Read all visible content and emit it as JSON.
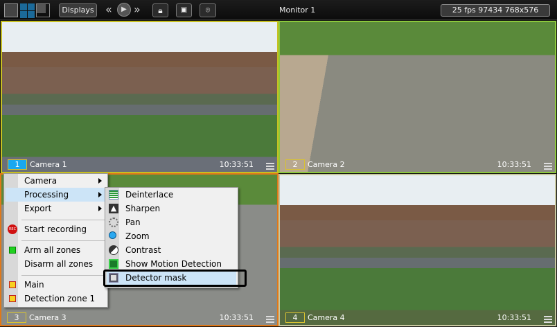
{
  "toolbar": {
    "displays_label": "Displays",
    "monitor_title": "Monitor 1",
    "status": "25 fps  97434 768x576"
  },
  "cameras": [
    {
      "num": "1",
      "name": "Camera 1",
      "time": "10:33:51",
      "border": "#c8c020"
    },
    {
      "num": "2",
      "name": "Camera 2",
      "time": "10:33:51",
      "border": "#8cc83c"
    },
    {
      "num": "3",
      "name": "Camera 3",
      "time": "10:33:51",
      "border": "#e07818"
    },
    {
      "num": "4",
      "name": "Camera 4",
      "time": "10:33:51",
      "border": "#c8c8a0"
    }
  ],
  "context_menu": {
    "items": [
      {
        "label": "Camera",
        "submenu": true
      },
      {
        "label": "Processing",
        "submenu": true,
        "highlighted": true
      },
      {
        "label": "Export",
        "submenu": true
      },
      {
        "label": "Start recording",
        "icon": "rec-icon"
      },
      {
        "label": "Arm all zones",
        "icon": "arm-zone-icon"
      },
      {
        "label": "Disarm all zones"
      },
      {
        "label": "Main",
        "icon": "zone-icon"
      },
      {
        "label": "Detection zone 1",
        "icon": "zone-icon"
      }
    ]
  },
  "processing_submenu": {
    "items": [
      {
        "label": "Deinterlace",
        "icon": "deinterlace-icon",
        "checked": true
      },
      {
        "label": "Sharpen",
        "icon": "sharpen-icon"
      },
      {
        "label": "Pan",
        "icon": "pan-icon"
      },
      {
        "label": "Zoom",
        "icon": "zoom-icon"
      },
      {
        "label": "Contrast",
        "icon": "contrast-icon"
      },
      {
        "label": "Show Motion Detection",
        "icon": "motion-detection-icon"
      },
      {
        "label": "Detector mask",
        "icon": "detector-mask-icon",
        "highlighted": true
      }
    ]
  }
}
